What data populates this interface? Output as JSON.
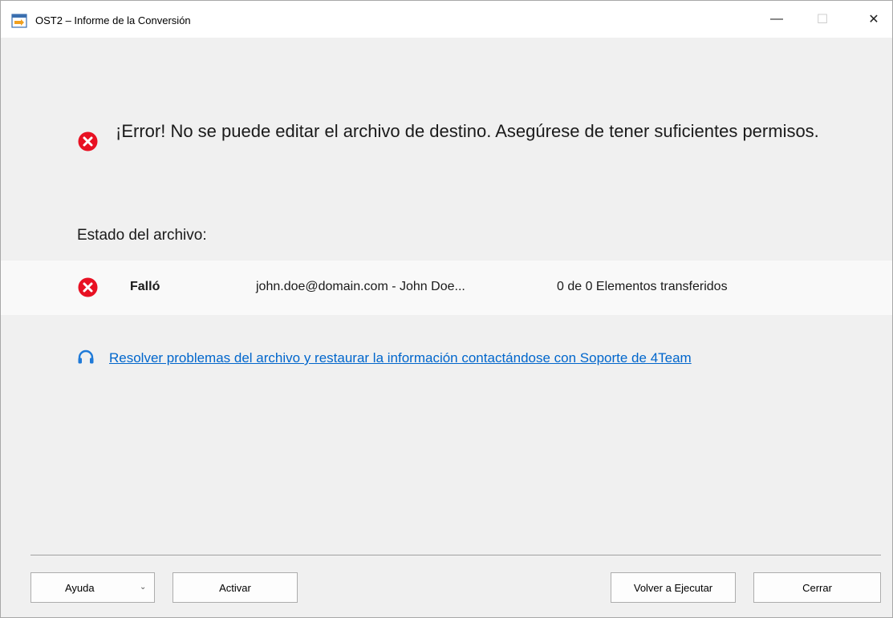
{
  "window": {
    "title": "OST2 – Informe de la Conversión",
    "controls": {
      "minimize": "—",
      "maximize": "☐",
      "close": "✕"
    }
  },
  "error": {
    "icon": "error-circle-icon",
    "message": "¡Error! No se puede editar el archivo de destino. Asegúrese de tener suficientes permisos."
  },
  "file_status": {
    "label": "Estado del archivo:",
    "rows": [
      {
        "icon": "error-circle-icon",
        "status": "Falló",
        "account": "john.doe@domain.com - John Doe...",
        "items": "0 de 0 Elementos transferidos"
      }
    ]
  },
  "support": {
    "icon": "headset-icon",
    "link_text": "Resolver problemas del archivo y restaurar la información contactándose con Soporte de 4Team"
  },
  "buttons": {
    "help": "Ayuda",
    "activate": "Activar",
    "rerun": "Volver a Ejecutar",
    "close": "Cerrar"
  },
  "colors": {
    "error_red": "#e81123",
    "link_blue": "#0066cc",
    "background": "#f0f0f0",
    "row_background": "#f9f9f9"
  }
}
